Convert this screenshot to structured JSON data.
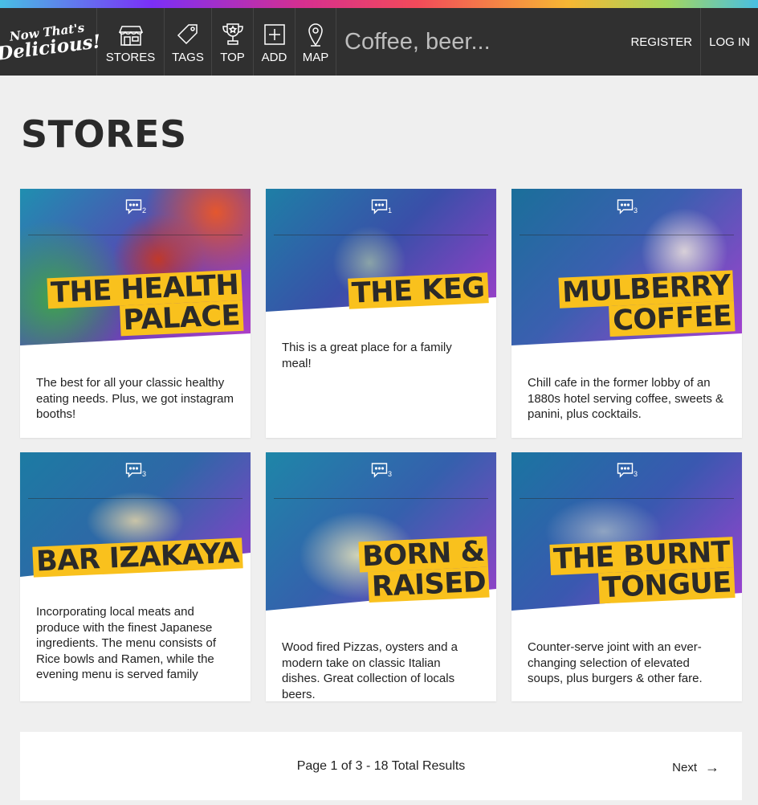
{
  "header": {
    "logo_line1": "Now That's",
    "logo_line2": "Delicious!",
    "nav": [
      {
        "label": "STORES",
        "icon": "store-icon"
      },
      {
        "label": "TAGS",
        "icon": "tag-icon"
      },
      {
        "label": "TOP",
        "icon": "trophy-icon"
      },
      {
        "label": "ADD",
        "icon": "add-icon"
      },
      {
        "label": "MAP",
        "icon": "map-pin-icon"
      }
    ],
    "search_placeholder": "Coffee, beer...",
    "register": "REGISTER",
    "login": "LOG IN"
  },
  "page_title": "STORES",
  "stores": [
    {
      "name_lines": [
        "THE HEALTH",
        "PALACE"
      ],
      "comments": "2",
      "description": "The best for all your classic healthy eating needs. Plus, we got instagram booths!"
    },
    {
      "name_lines": [
        "THE KEG"
      ],
      "comments": "1",
      "description": "This is a great place for a family meal!"
    },
    {
      "name_lines": [
        "MULBERRY",
        "COFFEE"
      ],
      "comments": "3",
      "description": "Chill cafe in the former lobby of an 1880s hotel serving coffee, sweets & panini, plus cocktails."
    },
    {
      "name_lines": [
        "BAR IZAKAYA"
      ],
      "comments": "3",
      "description": "Incorporating local meats and produce with the finest Japanese ingredients. The menu consists of Rice bowls and Ramen, while the evening menu is served family"
    },
    {
      "name_lines": [
        "BORN &",
        "RAISED"
      ],
      "comments": "3",
      "description": "Wood fired Pizzas, oysters and a modern take on classic Italian dishes. Great collection of locals beers."
    },
    {
      "name_lines": [
        "THE BURNT",
        "TONGUE"
      ],
      "comments": "3",
      "description": "Counter-serve joint with an ever-changing selection of elevated soups, plus burgers & other fare."
    }
  ],
  "pagination": {
    "info": "Page 1 of 3 - 18 Total Results",
    "next_label": "Next",
    "next_arrow": "→"
  },
  "colors": {
    "nav_bg": "#303030",
    "accent_yellow": "#f9c11d",
    "page_bg": "#efefef"
  }
}
